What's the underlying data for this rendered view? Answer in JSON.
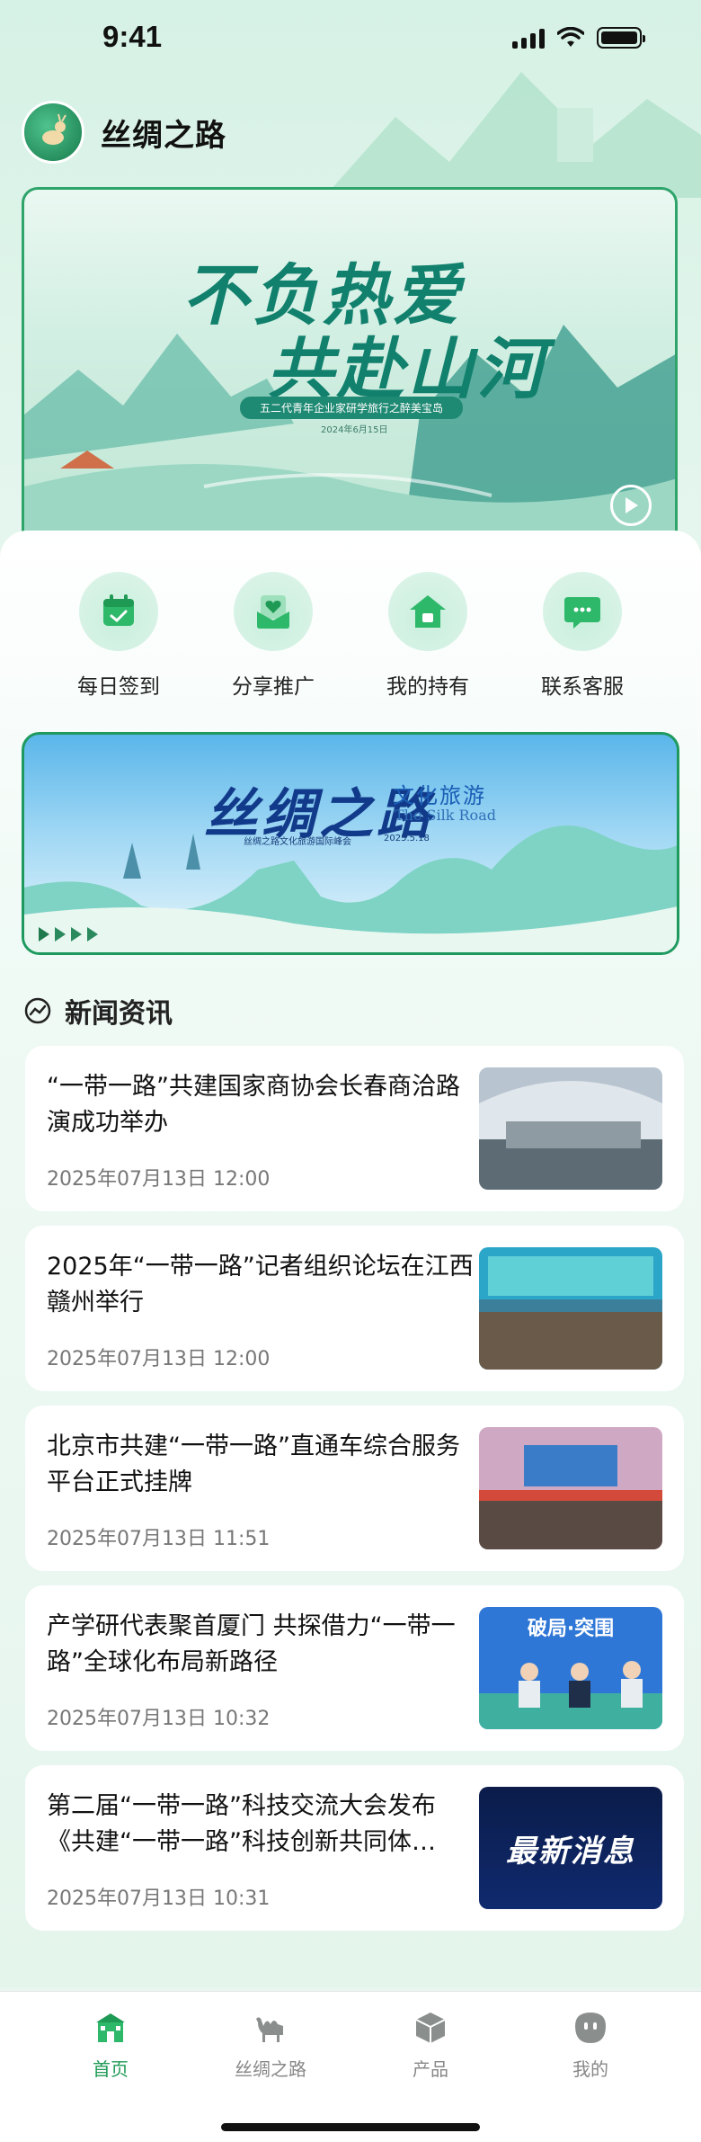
{
  "status_bar": {
    "time": "9:41"
  },
  "app": {
    "title": "丝绸之路"
  },
  "hero": {
    "title_line1": "不负热爱",
    "title_line2": "共赴山河",
    "subtitle": "五二代青年企业家研学旅行之醉美宝岛",
    "date": "2024年6月15日"
  },
  "quick_actions": [
    {
      "label": "每日签到",
      "icon": "calendar-check-icon"
    },
    {
      "label": "分享推广",
      "icon": "share-heart-icon"
    },
    {
      "label": "我的持有",
      "icon": "house-icon"
    },
    {
      "label": "联系客服",
      "icon": "chat-bubble-icon"
    }
  ],
  "banner2": {
    "title": "丝绸之路",
    "tag": "文化旅游",
    "en": "The Silk Road",
    "sub": "丝绸之路文化旅游国际峰会",
    "date": "2025.5.18"
  },
  "news": {
    "section_title": "新闻资讯",
    "items": [
      {
        "headline": "“一带一路”共建国家商协会长春商洽路演成功举办",
        "date": "2025年07月13日 12:00",
        "thumb": "conference-hall"
      },
      {
        "headline": "2025年“一带一路”记者组织论坛在江西赣州举行",
        "date": "2025年07月13日 12:00",
        "thumb": "forum-stage"
      },
      {
        "headline": "北京市共建“一带一路”直通车综合服务平台正式挂牌",
        "date": "2025年07月13日 11:51",
        "thumb": "ceremony"
      },
      {
        "headline": "产学研代表聚首厦门 共探借力“一带一路”全球化布局新路径",
        "date": "2025年07月13日 10:32",
        "thumb": "panel-discussion",
        "thumb_text": "破局·突围"
      },
      {
        "headline": "第二届“一带一路”科技交流大会发布《共建“一带一路”科技创新共同体…",
        "date": "2025年07月13日 10:31",
        "thumb": "latest-news",
        "thumb_text": "最新消息"
      }
    ]
  },
  "tabs": [
    {
      "label": "首页",
      "icon": "home-gate-icon",
      "active": true
    },
    {
      "label": "丝绸之路",
      "icon": "camel-icon",
      "active": false
    },
    {
      "label": "产品",
      "icon": "box-icon",
      "active": false
    },
    {
      "label": "我的",
      "icon": "profile-icon",
      "active": false
    }
  ],
  "colors": {
    "accent": "#1f9a55",
    "banner_border": "#2ea36a"
  }
}
